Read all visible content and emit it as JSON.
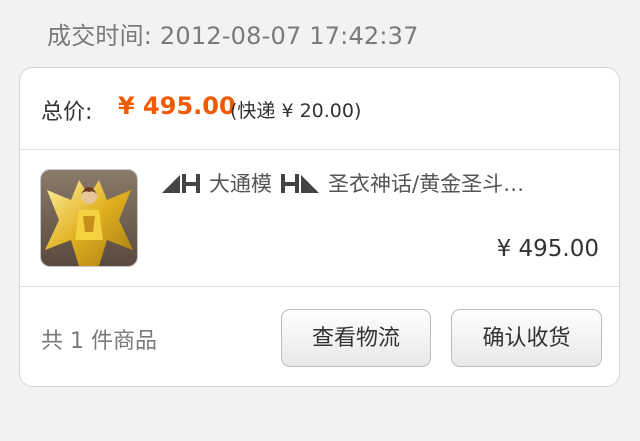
{
  "order": {
    "time_label": "成交时间: 2012-08-07 17:42:37"
  },
  "summary": {
    "total_label": "总价:",
    "total_price": "¥ 495.00",
    "shipping_note": "(快递 ¥ 20.00)"
  },
  "item": {
    "thumbnail_icon": "product-thumbnail",
    "left_logo_icon": "brand-logo-left-icon",
    "right_logo_icon": "brand-logo-right-icon",
    "title_part1": "大通模",
    "title_part2": "圣衣神话/黄金圣斗…",
    "price": "¥ 495.00"
  },
  "footer": {
    "count_text": "共 1 件商品",
    "logistics_button": "查看物流",
    "confirm_button": "确认收货"
  },
  "colors": {
    "accent_orange": "#f05a00",
    "background": "#f2f2f2"
  }
}
